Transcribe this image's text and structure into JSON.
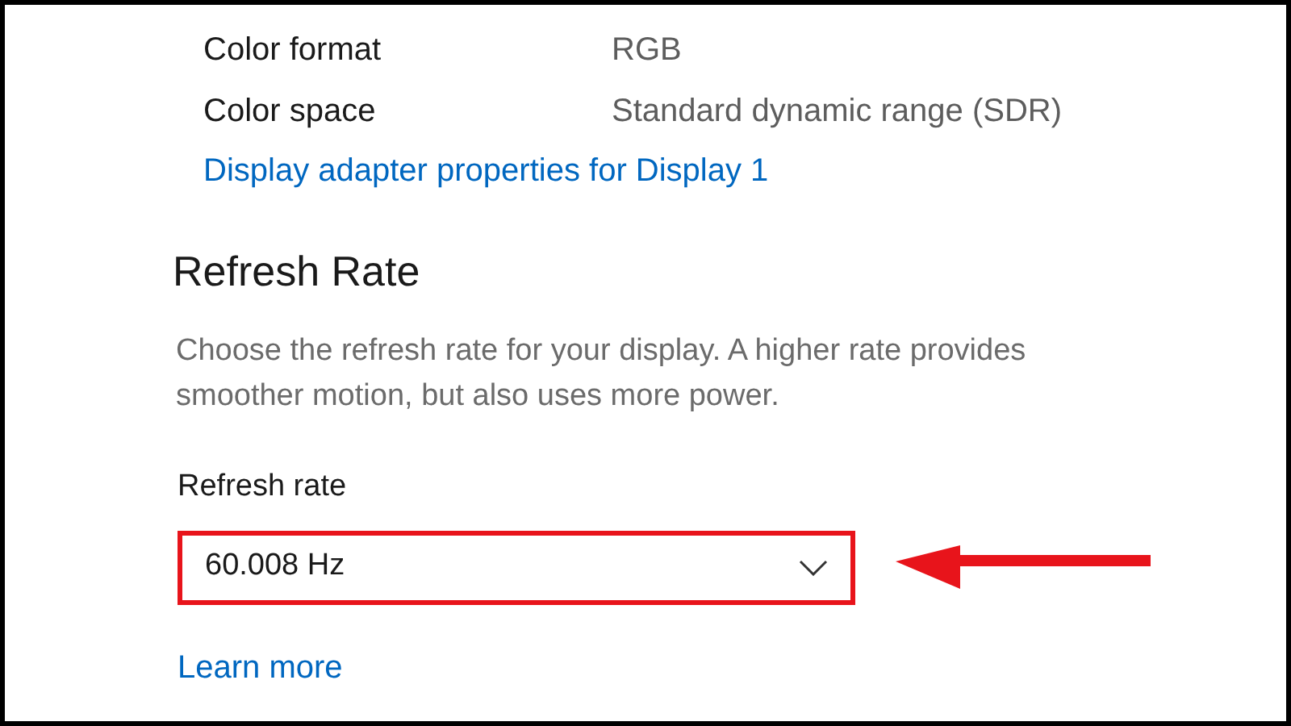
{
  "properties": [
    {
      "label": "Color format",
      "value": "RGB"
    },
    {
      "label": "Color space",
      "value": "Standard dynamic range (SDR)"
    }
  ],
  "adapter_link": "Display adapter properties for Display 1",
  "section": {
    "title": "Refresh Rate",
    "description": "Choose the refresh rate for your display. A higher rate provides smoother motion, but also uses more power."
  },
  "refresh_rate": {
    "label": "Refresh rate",
    "value": "60.008 Hz",
    "highlighted": true
  },
  "learn_more_link": "Learn more"
}
